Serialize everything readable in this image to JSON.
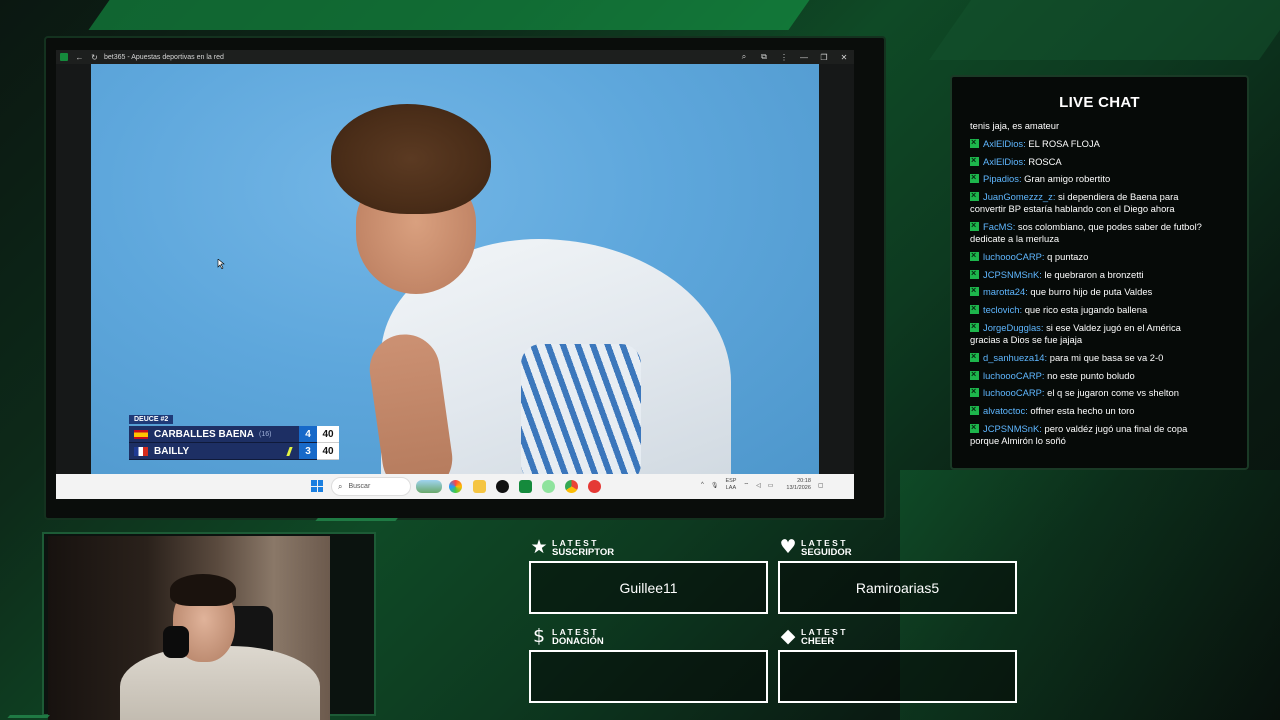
{
  "browser": {
    "tab_title": "bet365 - Apuestas deportivas en la red",
    "controls": {
      "minimize": "—",
      "restore": "❐",
      "close": "✕"
    }
  },
  "scoreboard": {
    "tag": "DEUCE #2",
    "players": [
      {
        "name": "CARBALLES BAENA",
        "seed": "(16)",
        "set": "4",
        "points": "40",
        "flag": "es",
        "serving": false
      },
      {
        "name": "BAILLY",
        "seed": "",
        "set": "3",
        "points": "40",
        "flag": "fr",
        "serving": true
      }
    ]
  },
  "taskbar": {
    "search_placeholder": "Buscar",
    "lang_top": "ESP",
    "lang_bottom": "LAA",
    "time": "20:18",
    "date": "13/1/2026"
  },
  "chat": {
    "title": "LIVE CHAT",
    "first_line": "tenis jaja, es amateur",
    "messages": [
      {
        "user": "AxlElDios",
        "text": " EL ROSA FLOJA"
      },
      {
        "user": "AxlElDios",
        "text": " ROSCA"
      },
      {
        "user": "Pipadios",
        "text": " Gran amigo robertito"
      },
      {
        "user": "JuanGomezzz_z",
        "text": " si dependiera de Baena para",
        "cont": "convertir BP estaría hablando con el Diego ahora"
      },
      {
        "user": "FacMS",
        "text": " sos colombiano, que podes saber de futbol?",
        "cont": "dedicate a la merluza"
      },
      {
        "user": "luchoooCARP",
        "text": " q puntazo"
      },
      {
        "user": "JCPSNMSnK",
        "text": " le quebraron a bronzetti"
      },
      {
        "user": "marotta24",
        "text": " que burro hijo de puta Valdes"
      },
      {
        "user": "teclovich",
        "text": " que rico esta jugando ballena"
      },
      {
        "user": "JorgeDugglas",
        "text": " si ese Valdez jugó en el América",
        "cont": "gracias a Dios se fue jajaja"
      },
      {
        "user": "d_sanhueza14",
        "text": " para mi que basa se va 2-0"
      },
      {
        "user": "luchoooCARP",
        "text": " no este punto boludo"
      },
      {
        "user": "luchoooCARP",
        "text": " el q se jugaron come vs shelton"
      },
      {
        "user": "alvatoctoc",
        "text": " offner esta hecho un toro"
      },
      {
        "user": "JCPSNMSnK",
        "text": " pero valdéz jugó una final de copa",
        "cont": "porque Almirón lo soñó"
      }
    ]
  },
  "widgets": {
    "suscriptor": {
      "latest": "LATEST",
      "kind": "SUSCRIPTOR",
      "value": "Guillee11",
      "icon": "star-icon"
    },
    "seguidor": {
      "latest": "LATEST",
      "kind": "SEGUIDOR",
      "value": "Ramiroarias5",
      "icon": "heart-icon"
    },
    "donacion": {
      "latest": "LATEST",
      "kind": "DONACIÓN",
      "value": "",
      "icon": "dollar-icon"
    },
    "cheer": {
      "latest": "LATEST",
      "kind": "CHEER",
      "value": "",
      "icon": "diamond-icon"
    }
  },
  "colors": {
    "accent_green": "#1db64c",
    "chat_username": "#5fb7ff",
    "scoreboard_navy": "#1d2f64",
    "scoreboard_blue": "#1769c9"
  }
}
